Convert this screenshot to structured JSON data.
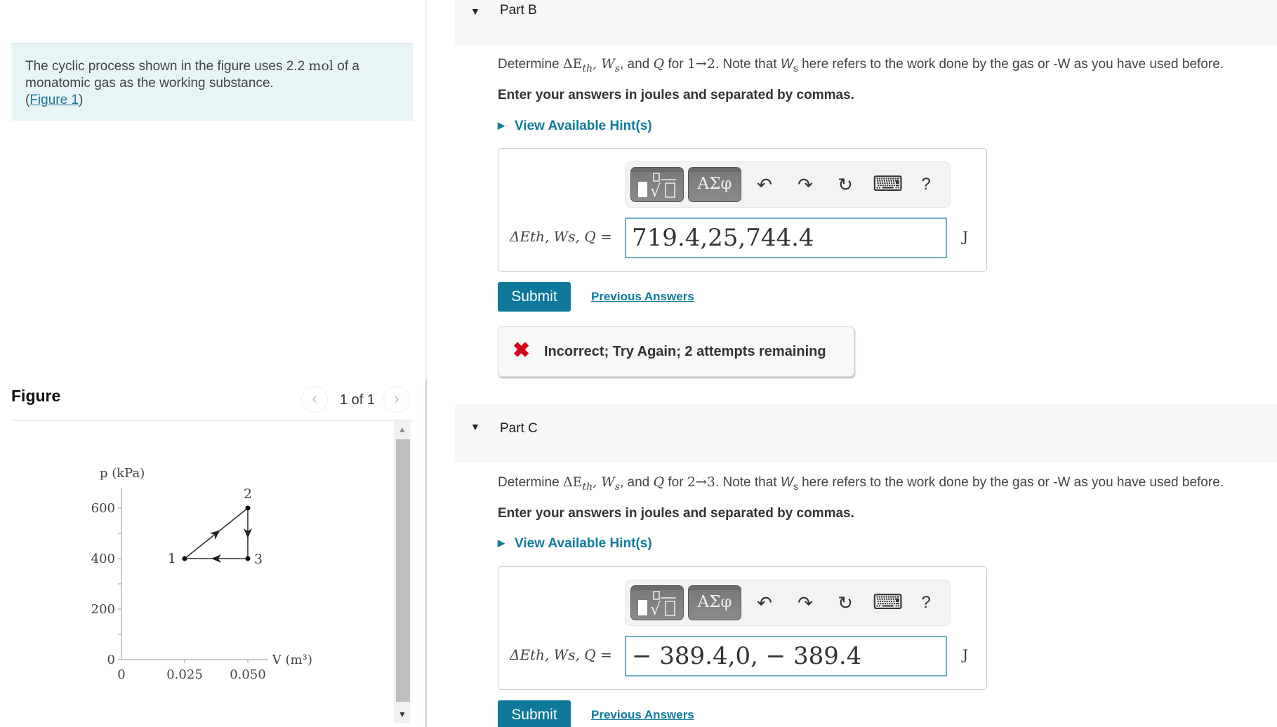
{
  "intro": {
    "text_before": "The cyclic process shown in the figure uses 2.2 ",
    "unit": "mol",
    "text_after": " of a monatomic gas as the working substance.",
    "figure_link_open": "(",
    "figure_link": "Figure 1",
    "figure_link_close": ")"
  },
  "figure_panel": {
    "title": "Figure",
    "counter": "1 of 1",
    "prev_icon": "chevron-left-icon",
    "next_icon": "chevron-right-icon",
    "prev_glyph": "‹",
    "next_glyph": "›",
    "scroll_up_glyph": "▲",
    "scroll_down_glyph": "▼"
  },
  "chart_data": {
    "type": "line",
    "title": "",
    "xlabel": "V (m³)",
    "ylabel": "p (kPa)",
    "xlim": [
      0,
      0.058
    ],
    "ylim": [
      0,
      680
    ],
    "x_ticks": [
      0,
      0.025,
      0.05
    ],
    "x_tick_labels": [
      "0",
      "0.025",
      "0.050"
    ],
    "y_ticks": [
      0,
      100,
      200,
      300,
      400,
      500,
      600
    ],
    "y_tick_labels": [
      "0",
      "",
      "200",
      "",
      "400",
      "",
      "600"
    ],
    "grid": false,
    "points": [
      {
        "label": "1",
        "x": 0.025,
        "y": 400
      },
      {
        "label": "2",
        "x": 0.05,
        "y": 600
      },
      {
        "label": "3",
        "x": 0.05,
        "y": 400
      }
    ],
    "path_order": [
      "1",
      "2",
      "3",
      "1"
    ],
    "arrows": [
      "1→2",
      "2→3",
      "3→1"
    ]
  },
  "parts": [
    {
      "label": "Part B",
      "question_prefix": "Determine ",
      "question_vars": "ΔE",
      "question_sub": "th",
      "question_mid": ", W",
      "question_sub2": "s",
      "question_and": ", and ",
      "question_q": "Q",
      "question_for": " for ",
      "question_transition": "1→2",
      "question_note": ". Note that ",
      "question_ws": "W",
      "question_ws_sub": "s",
      "question_tail": " here refers to the work done by the gas or -W as you have used before.",
      "instruction": "Enter your answers in joules and separated by commas.",
      "hint_label": "View Available Hint(s)",
      "equation_label": "ΔEth, Ws, Q =",
      "answer_value": "719.4,25,744.4",
      "unit": "J",
      "submit_label": "Submit",
      "previous_answers_label": "Previous Answers",
      "feedback": {
        "icon": "x-mark-icon",
        "glyph": "✖",
        "message": "Incorrect; Try Again; 2 attempts remaining",
        "color": "#d6001c"
      }
    },
    {
      "label": "Part C",
      "question_prefix": "Determine ",
      "question_vars": "ΔE",
      "question_sub": "th",
      "question_mid": ", W",
      "question_sub2": "s",
      "question_and": ", and ",
      "question_q": "Q",
      "question_for": " for ",
      "question_transition": "2→3",
      "question_note": ". Note that ",
      "question_ws": "W",
      "question_ws_sub": "s",
      "question_tail": " here refers to the work done by the gas or -W as you have used before.",
      "instruction": "Enter your answers in joules and separated by commas.",
      "hint_label": "View Available Hint(s)",
      "equation_label": "ΔEth, Ws, Q =",
      "answer_value": "− 389.4,0, − 389.4",
      "unit": "J",
      "submit_label": "Submit",
      "previous_answers_label": "Previous Answers"
    }
  ],
  "toolbar": {
    "template_icon": "templates-icon",
    "greek_label": "ΑΣφ",
    "undo_glyph": "↶",
    "redo_glyph": "↷",
    "reset_glyph": "↻",
    "keyboard_glyph": "⌨",
    "help_glyph": "?"
  },
  "colors": {
    "accent": "#0e789a",
    "link": "#0e7a9c",
    "intro_bg": "#e7f5f6",
    "error": "#d6001c"
  }
}
